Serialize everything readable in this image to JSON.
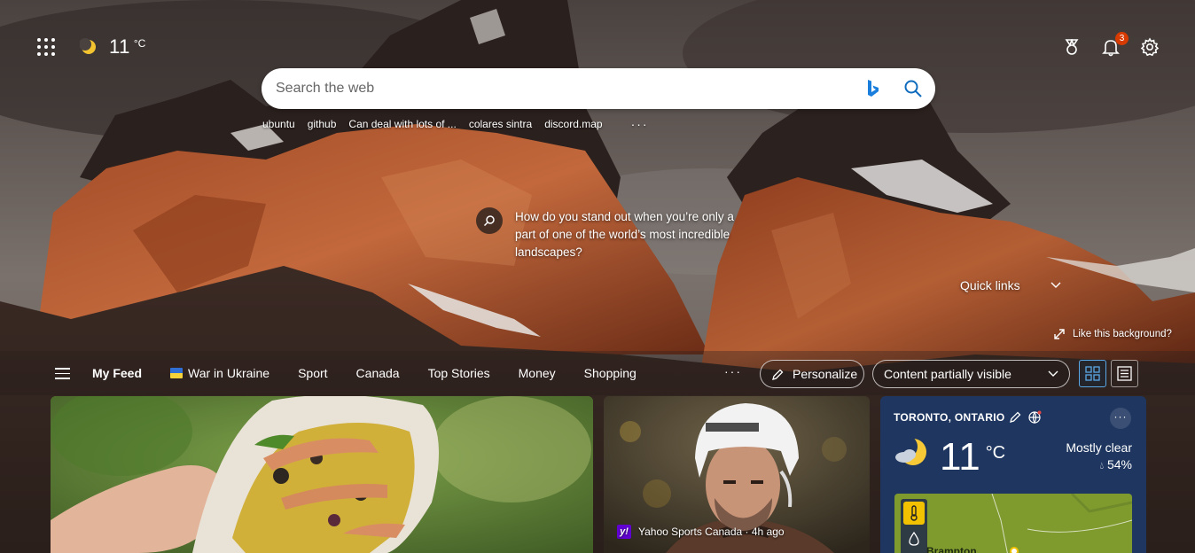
{
  "weather_mini": {
    "temperature": "11",
    "unit": "°C",
    "icon": "moon-icon"
  },
  "header": {
    "notification_count": "3",
    "icons": [
      "rewards-icon",
      "bell-icon",
      "gear-icon"
    ]
  },
  "search": {
    "placeholder": "Search the web"
  },
  "quick_searches": [
    "ubuntu",
    "github",
    "Can deal with lots of ...",
    "colares sintra",
    "discord.map"
  ],
  "quick_searches_more": "···",
  "caption": {
    "text": "How do you stand out when you’re only a part of one of the world’s most incredible landscapes?"
  },
  "quick_links": {
    "label": "Quick links"
  },
  "like_background": {
    "label": "Like this background?"
  },
  "feed_nav": {
    "items": [
      "My Feed",
      "War in Ukraine",
      "Sport",
      "Canada",
      "Top Stories",
      "Money",
      "Shopping"
    ],
    "more": "···",
    "personalize_label": "Personalize",
    "content_select_value": "Content partially visible"
  },
  "cards": {
    "hockey_source": "Yahoo Sports Canada · 4h ago",
    "yahoo_logo_text": "y!"
  },
  "weather_card": {
    "location": "TORONTO, ONTARIO",
    "temperature": "11",
    "unit": "°C",
    "condition": "Mostly clear",
    "precip": "54%",
    "map_city": "Brampton",
    "more": "···"
  },
  "colors": {
    "accent": "#0078d4",
    "badge": "#d83b01",
    "weather_bg": "#1f3760"
  }
}
